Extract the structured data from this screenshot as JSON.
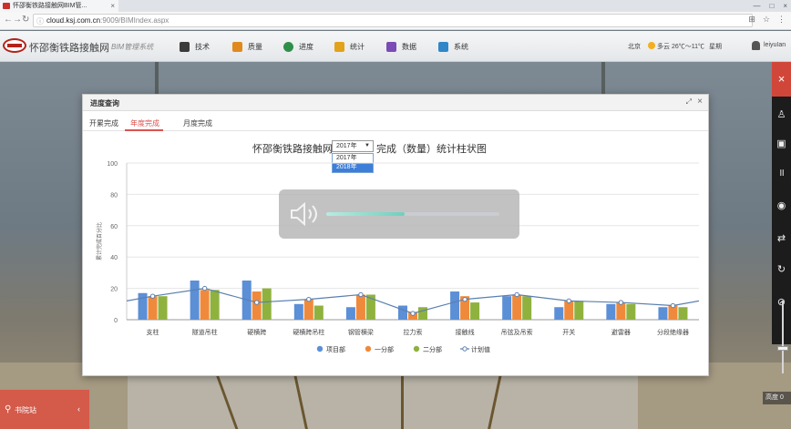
{
  "browser": {
    "tab_title": "怀邵衡铁路接触网BIM管...",
    "url_host": "cloud.ksj.com.cn",
    "url_path": ":9009/BIMIndex.aspx"
  },
  "app": {
    "title": "怀邵衡铁路接触网",
    "subtitle": "BIM管理系统",
    "menu": [
      {
        "label": "技术",
        "icon": "tools-icon",
        "color": "#3b3b3b"
      },
      {
        "label": "质量",
        "icon": "quality-icon",
        "color": "#e08a1e"
      },
      {
        "label": "进度",
        "icon": "progress-icon",
        "color": "#2f8f4a"
      },
      {
        "label": "统计",
        "icon": "stats-icon",
        "color": "#e2a21b"
      },
      {
        "label": "数据",
        "icon": "data-icon",
        "color": "#7b4bb5"
      },
      {
        "label": "系统",
        "icon": "system-icon",
        "color": "#2f86c8"
      }
    ],
    "location": "北京",
    "weather": "多云 26℃～11℃",
    "weekday": "星期",
    "user": "leiyuIan"
  },
  "dialog": {
    "title": "进度查询",
    "tabs": [
      "开累完成",
      "年度完成",
      "月度完成"
    ],
    "active_tab": 1,
    "chart_title_prefix": "怀邵衡铁路接触网",
    "chart_title_suffix": "完成（数量）统计柱状图",
    "year_selected": "2017年",
    "year_options": [
      "2017年",
      "2018年"
    ],
    "year_highlighted": 1
  },
  "station": {
    "label": "书院站"
  },
  "zoom_label": "高度 0",
  "volume": {
    "level": 0.45
  },
  "chart_data": {
    "type": "bar",
    "categories": [
      "支柱",
      "隧道吊柱",
      "硬横跨",
      "硬横跨吊柱",
      "钢管横梁",
      "拉力索",
      "接触线",
      "吊弦及吊索",
      "开关",
      "避雷器",
      "分段绝缘器"
    ],
    "ylabel": "累计完成百分比",
    "ylim": [
      0,
      100
    ],
    "yticks": [
      0,
      20,
      40,
      60,
      80,
      100
    ],
    "series": [
      {
        "name": "项目部",
        "type": "bar",
        "color": "#5b8fd6",
        "values": [
          17,
          25,
          25,
          10,
          8,
          9,
          18,
          15,
          8,
          10,
          8
        ]
      },
      {
        "name": "一分部",
        "type": "bar",
        "color": "#ef8a3c",
        "values": [
          15,
          19,
          18,
          13,
          16,
          5,
          15,
          16,
          12,
          11,
          9
        ]
      },
      {
        "name": "二分部",
        "type": "bar",
        "color": "#8fb23f",
        "values": [
          15,
          19,
          20,
          9,
          16,
          8,
          11,
          15,
          12,
          10,
          8
        ]
      },
      {
        "name": "计划值",
        "type": "line",
        "color": "#5a7fb0",
        "values": [
          15,
          20,
          11,
          13,
          16,
          4,
          13,
          16,
          12,
          11,
          9
        ]
      }
    ],
    "legend_position": "bottom",
    "grid": true
  }
}
